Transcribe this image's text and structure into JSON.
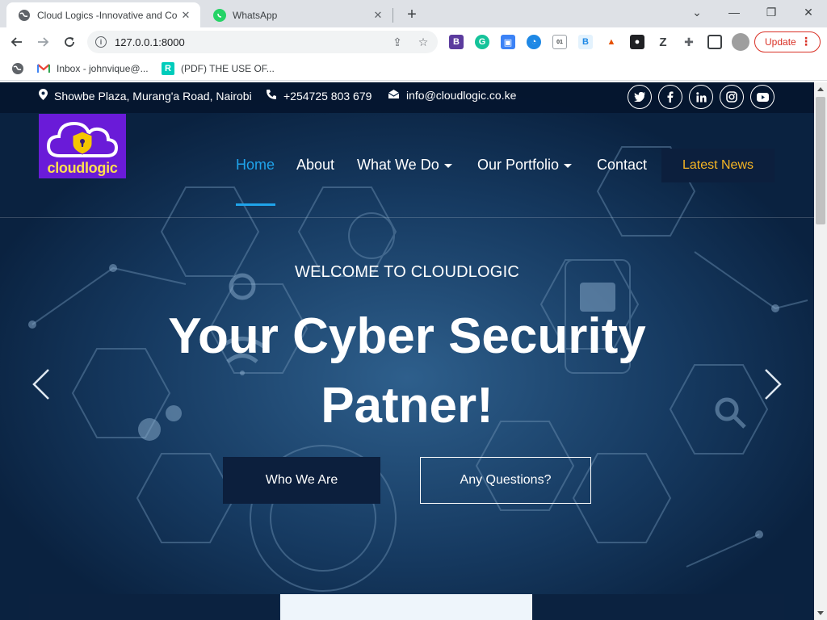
{
  "browser": {
    "tabs": [
      {
        "title": "Cloud Logics -Innovative and Co",
        "active": true
      },
      {
        "title": "WhatsApp",
        "active": false
      }
    ],
    "url": "127.0.0.1:8000",
    "update_label": "Update",
    "bookmarks": [
      {
        "label": "Inbox - johnvique@..."
      },
      {
        "label": "(PDF) THE USE OF..."
      }
    ]
  },
  "site": {
    "topbar": {
      "address": "Showbe Plaza, Murang'a Road, Nairobi",
      "phone": "+254725 803 679",
      "email": "info@cloudlogic.co.ke"
    },
    "logo_text": "cloudlogic",
    "nav": {
      "home": "Home",
      "about": "About",
      "what_we_do": "What We Do",
      "portfolio": "Our Portfolio",
      "contact": "Contact",
      "latest_news": "Latest News"
    },
    "hero": {
      "welcome": "WELCOME TO CLOUDLOGIC",
      "headline": "Your Cyber Security Patner!",
      "btn_primary": "Who We Are",
      "btn_secondary": "Any Questions?"
    }
  },
  "colors": {
    "accent": "#1fa3ea",
    "news": "#f6b523",
    "navy": "#0b2444",
    "logo_bg": "#6a1bd8"
  }
}
